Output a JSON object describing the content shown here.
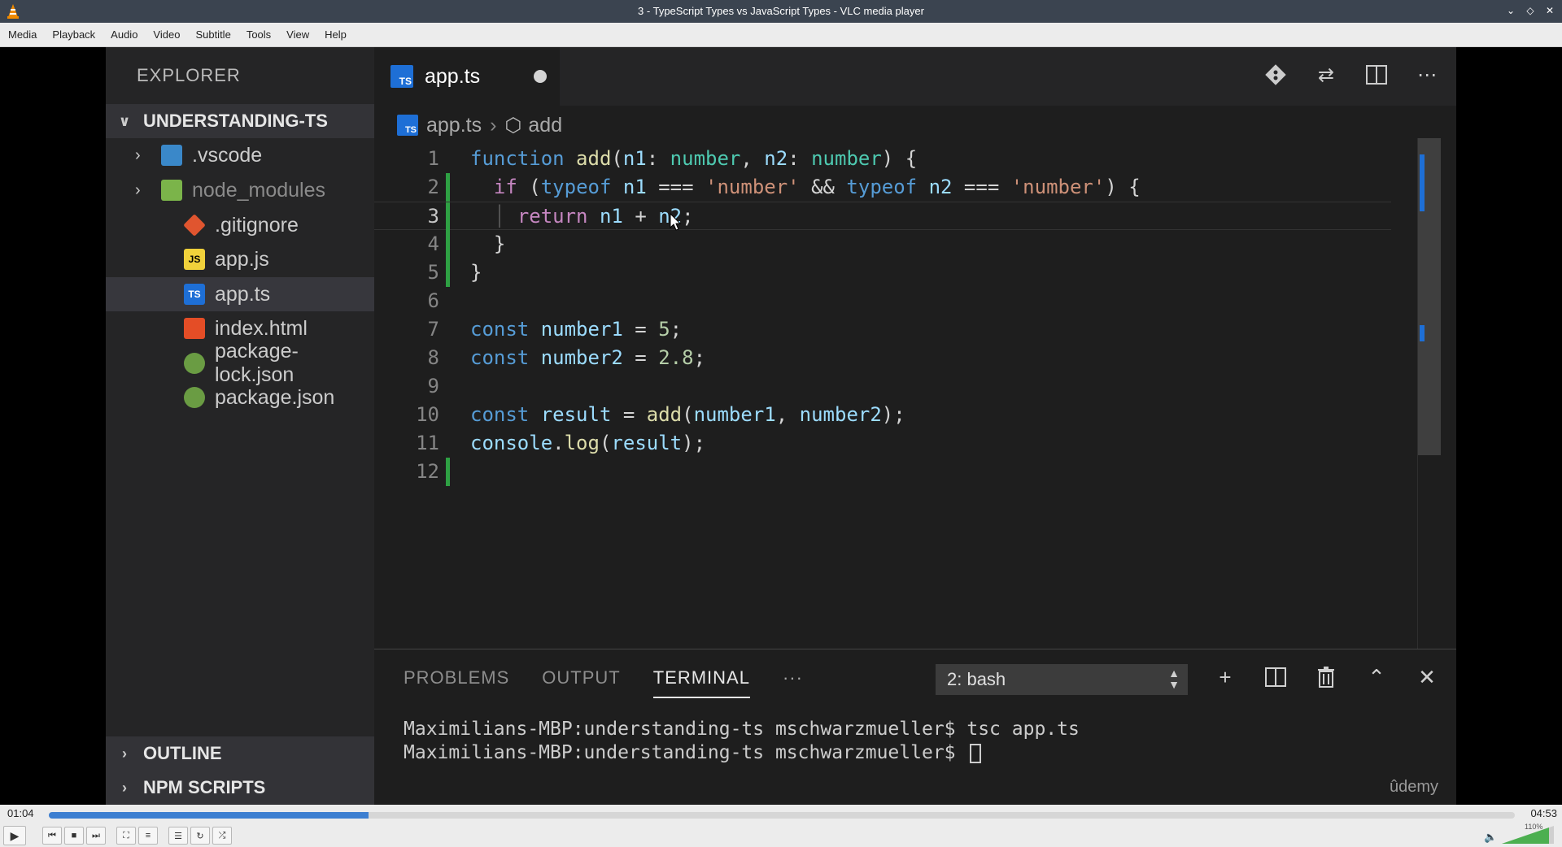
{
  "window": {
    "title": "3 - TypeScript Types vs JavaScript Types - VLC media player"
  },
  "menu": [
    "Media",
    "Playback",
    "Audio",
    "Video",
    "Subtitle",
    "Tools",
    "View",
    "Help"
  ],
  "explorer": {
    "title": "EXPLORER",
    "project": "UNDERSTANDING-TS",
    "items": [
      {
        "label": ".vscode",
        "icon": "folder-vscode-icon"
      },
      {
        "label": "node_modules",
        "icon": "folder-node-icon"
      },
      {
        "label": ".gitignore",
        "icon": "git-icon"
      },
      {
        "label": "app.js",
        "icon": "js-file-icon"
      },
      {
        "label": "app.ts",
        "icon": "ts-file-icon"
      },
      {
        "label": "index.html",
        "icon": "html-file-icon"
      },
      {
        "label": "package-lock.json",
        "icon": "node-json-icon"
      },
      {
        "label": "package.json",
        "icon": "node-json-icon"
      }
    ],
    "outline": "OUTLINE",
    "npm_scripts": "NPM SCRIPTS"
  },
  "editor": {
    "tab_label": "app.ts",
    "ts_badge": "TS",
    "js_badge": "JS",
    "breadcrumb": {
      "file": "app.ts",
      "symbol": "add"
    },
    "line_numbers": [
      "1",
      "2",
      "3",
      "4",
      "5",
      "6",
      "7",
      "8",
      "9",
      "10",
      "11",
      "12"
    ]
  },
  "panel": {
    "tabs": [
      "PROBLEMS",
      "OUTPUT",
      "TERMINAL"
    ],
    "more": "···",
    "terminal_select": "2: bash",
    "terminal_lines": [
      "Maximilians-MBP:understanding-ts mschwarzmueller$ tsc app.ts",
      "Maximilians-MBP:understanding-ts mschwarzmueller$ "
    ],
    "watermark": "ûdemy"
  },
  "player": {
    "current_time": "01:04",
    "total_time": "04:53",
    "progress_fraction": 0.218,
    "volume_label": "110%",
    "accent_color": "#3d7fd1"
  }
}
